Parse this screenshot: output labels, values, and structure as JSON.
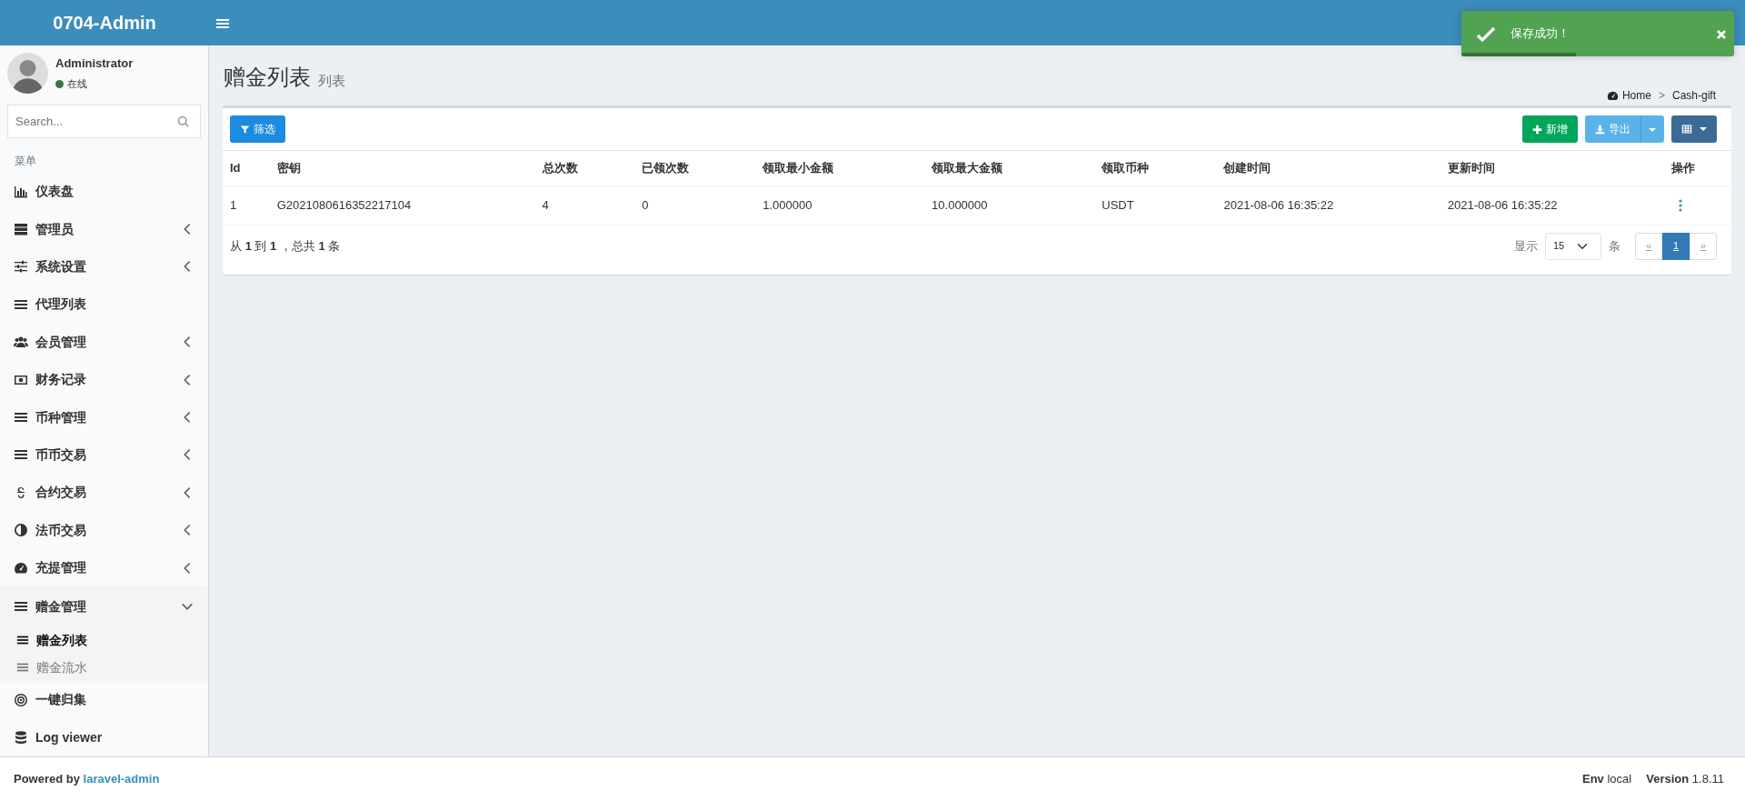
{
  "brand": "0704-Admin",
  "toast": {
    "message": "保存成功！",
    "level": 0.42
  },
  "sidebar": {
    "user": {
      "name": "Administrator",
      "status": "在线"
    },
    "search": {
      "placeholder": "Search..."
    },
    "header": "菜单",
    "items": [
      {
        "label": "仪表盘"
      },
      {
        "label": "管理员",
        "expanded": false
      },
      {
        "label": "系统设置",
        "expanded": false
      },
      {
        "label": "代理列表"
      },
      {
        "label": "会员管理",
        "expanded": false
      },
      {
        "label": "财务记录",
        "expanded": false
      },
      {
        "label": "币种管理",
        "expanded": false
      },
      {
        "label": "币币交易",
        "expanded": false
      },
      {
        "label": "合约交易",
        "expanded": false
      },
      {
        "label": "法币交易",
        "expanded": false
      },
      {
        "label": "充提管理",
        "expanded": false
      },
      {
        "label": "赠金管理",
        "expanded": true,
        "children": [
          {
            "label": "赠金列表",
            "selected": true
          },
          {
            "label": "赠金流水",
            "selected": false
          }
        ]
      },
      {
        "label": "一键归集"
      },
      {
        "label": "Log viewer"
      }
    ]
  },
  "page": {
    "title": "赠金列表",
    "subtitle": "列表",
    "breadcrumb": [
      "Home",
      "Cash-gift"
    ],
    "breadcrumb_separator": ">"
  },
  "toolbar": {
    "filter": "筛选",
    "create": "新增",
    "export": "导出"
  },
  "table": {
    "columns": [
      "Id",
      "密钥",
      "总次数",
      "已领次数",
      "领取最小金额",
      "领取最大金额",
      "领取币种",
      "创建时间",
      "更新时间",
      "操作"
    ],
    "rows": [
      [
        "1",
        "G2021080616352217104",
        "4",
        "0",
        "1.000000",
        "10.000000",
        "USDT",
        "2021-08-06 16:35:22",
        "2021-08-06 16:35:22"
      ]
    ]
  },
  "summary": "从 **1** 到 **1** ，总共 **1** 条",
  "pagination": {
    "show": "显示",
    "per_page": "15",
    "unit": "条",
    "prev": "«",
    "next": "»",
    "pages": [
      {
        "label": "1",
        "selected": true
      }
    ]
  },
  "footer": {
    "powered": "Powered by",
    "link": "laravel-admin",
    "env_label": "Env",
    "env": "local",
    "version_label": "Version",
    "version": "1.8.11"
  }
}
